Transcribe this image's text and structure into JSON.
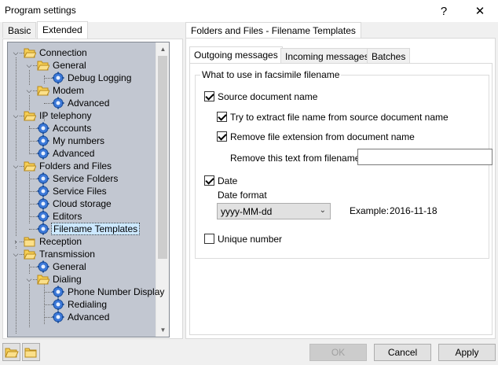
{
  "window": {
    "title": "Program settings",
    "help_glyph": "?",
    "close_glyph": "✕"
  },
  "left_tabs": [
    {
      "label": "Basic",
      "active": false
    },
    {
      "label": "Extended",
      "active": true
    }
  ],
  "tree": {
    "items": [
      {
        "label": "Connection",
        "level": 0,
        "icon": "folder-open-icon",
        "expander": "expanded"
      },
      {
        "label": "General",
        "level": 1,
        "icon": "folder-open-icon",
        "expander": "expanded"
      },
      {
        "label": "Debug Logging",
        "level": 2,
        "icon": "gear-icon",
        "expander": "none"
      },
      {
        "label": "Modem",
        "level": 1,
        "icon": "folder-open-icon",
        "expander": "expanded"
      },
      {
        "label": "Advanced",
        "level": 2,
        "icon": "gear-icon",
        "expander": "none"
      },
      {
        "label": "IP telephony",
        "level": 0,
        "icon": "folder-open-icon",
        "expander": "expanded"
      },
      {
        "label": "Accounts",
        "level": 1,
        "icon": "gear-icon",
        "expander": "none"
      },
      {
        "label": "My numbers",
        "level": 1,
        "icon": "gear-icon",
        "expander": "none"
      },
      {
        "label": "Advanced",
        "level": 1,
        "icon": "gear-icon",
        "expander": "none"
      },
      {
        "label": "Folders and Files",
        "level": 0,
        "icon": "folder-open-icon",
        "expander": "expanded"
      },
      {
        "label": "Service Folders",
        "level": 1,
        "icon": "gear-icon",
        "expander": "none"
      },
      {
        "label": "Service Files",
        "level": 1,
        "icon": "gear-icon",
        "expander": "none"
      },
      {
        "label": "Cloud storage",
        "level": 1,
        "icon": "gear-icon",
        "expander": "none"
      },
      {
        "label": "Editors",
        "level": 1,
        "icon": "gear-icon",
        "expander": "none"
      },
      {
        "label": "Filename Templates",
        "level": 1,
        "icon": "gear-icon",
        "expander": "none",
        "selected": true
      },
      {
        "label": "Reception",
        "level": 0,
        "icon": "folder-closed-icon",
        "expander": "collapsed"
      },
      {
        "label": "Transmission",
        "level": 0,
        "icon": "folder-open-icon",
        "expander": "expanded"
      },
      {
        "label": "General",
        "level": 1,
        "icon": "gear-icon",
        "expander": "none"
      },
      {
        "label": "Dialing",
        "level": 1,
        "icon": "folder-open-icon",
        "expander": "expanded"
      },
      {
        "label": "Phone Number Display",
        "level": 2,
        "icon": "gear-icon",
        "expander": "none"
      },
      {
        "label": "Redialing",
        "level": 2,
        "icon": "gear-icon",
        "expander": "none"
      },
      {
        "label": "Advanced",
        "level": 2,
        "icon": "gear-icon",
        "expander": "none"
      }
    ]
  },
  "right_tab": "Folders and Files - Filename Templates",
  "inner_tabs": [
    {
      "label": "Outgoing messages",
      "active": true
    },
    {
      "label": "Incoming messages",
      "active": false
    },
    {
      "label": "Batches",
      "active": false
    }
  ],
  "group": {
    "title": "What to use in facsimile filename",
    "source_doc": {
      "label": "Source document name",
      "checked": true
    },
    "extract": {
      "label": "Try to extract file name from source document name",
      "checked": true
    },
    "remove_ext": {
      "label": "Remove file extension from document name",
      "checked": true
    },
    "remove_text": {
      "label": "Remove this text from filename",
      "value": ""
    },
    "date": {
      "label": "Date",
      "checked": true
    },
    "date_format": {
      "label": "Date format",
      "value": "yyyy-MM-dd"
    },
    "example": {
      "label": "Example:",
      "value": "2016-11-18"
    }
  },
  "unique": {
    "label": "Unique number",
    "checked": false
  },
  "buttons": {
    "ok": "OK",
    "cancel": "Cancel",
    "apply": "Apply"
  }
}
